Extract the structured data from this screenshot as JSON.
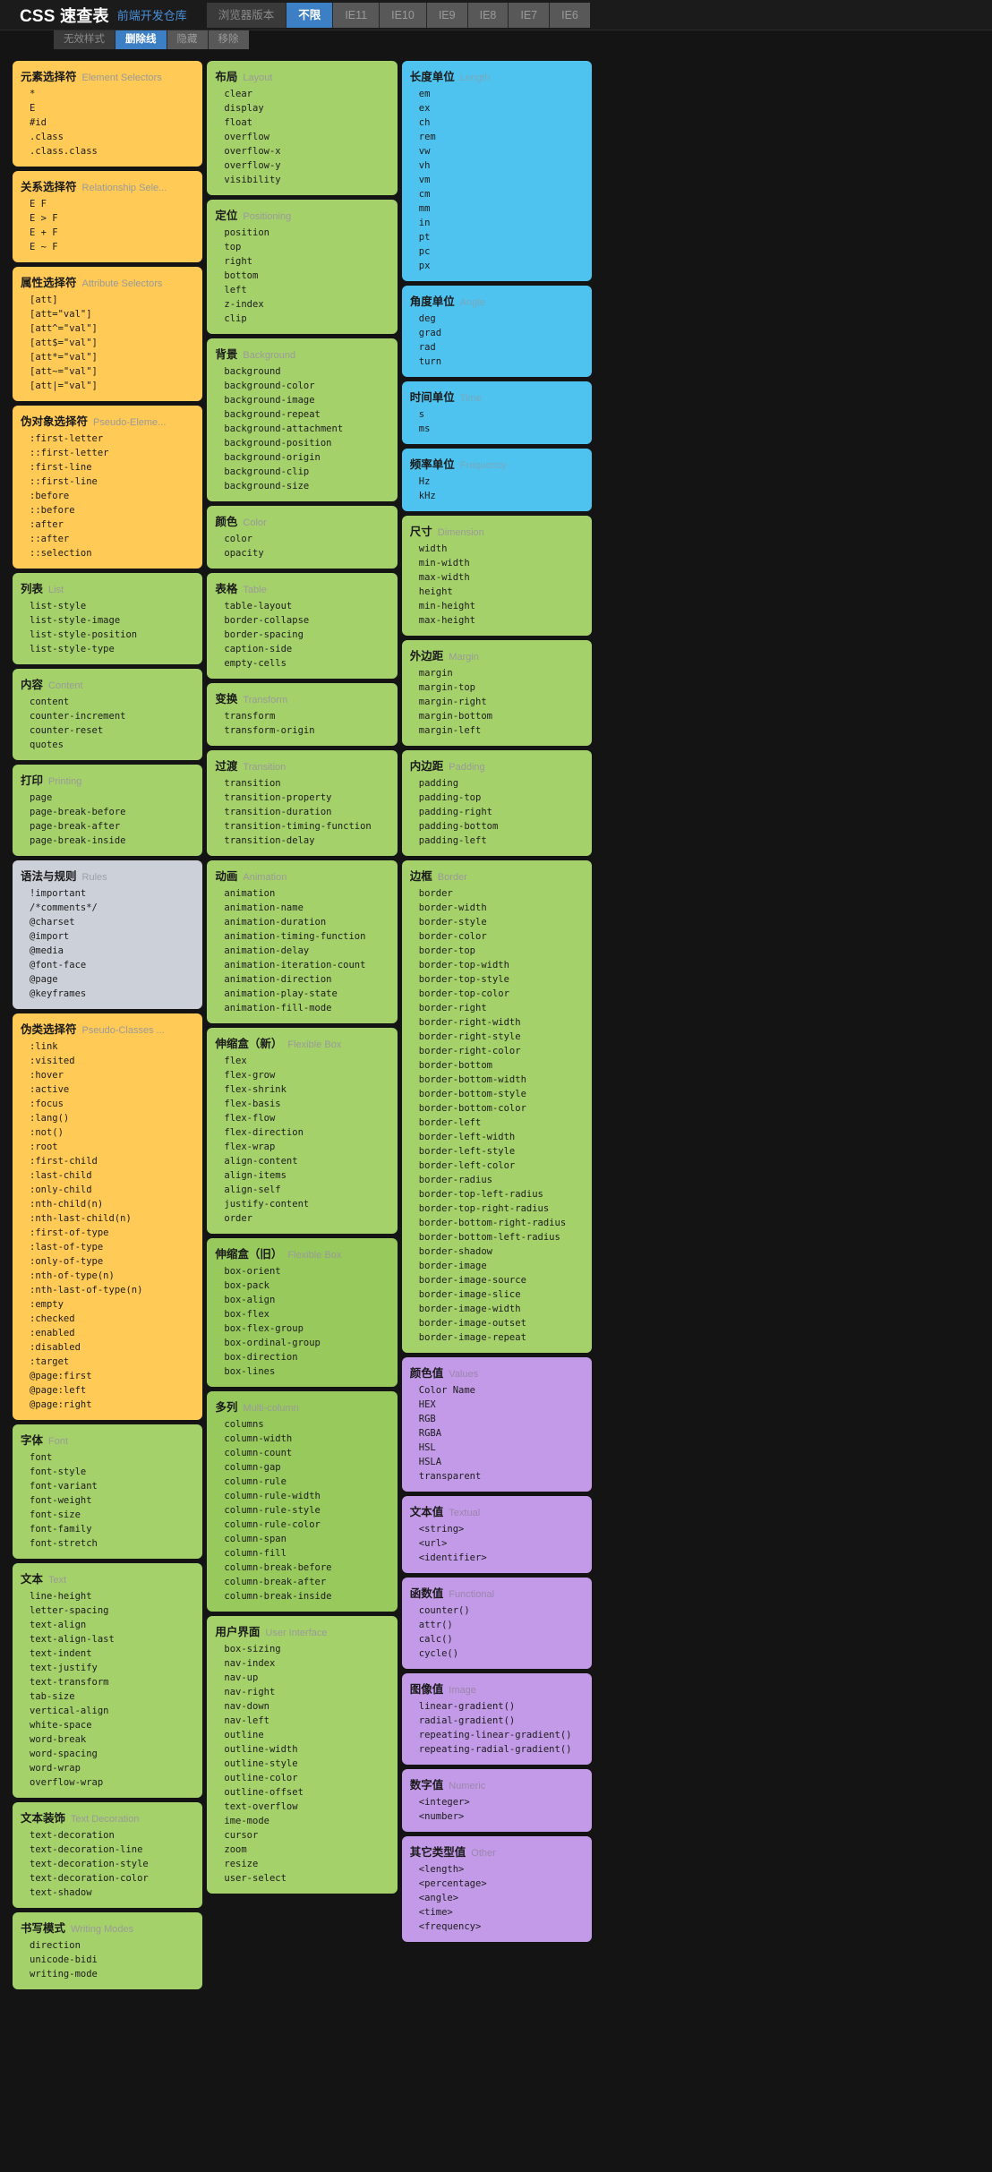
{
  "header": {
    "title_en": "CSS",
    "title_cn": "速查表",
    "subtitle": "前端开发仓库",
    "browser_label": "浏览器版本",
    "browser_options": [
      "不限",
      "IE11",
      "IE10",
      "IE9",
      "IE8",
      "IE7",
      "IE6"
    ],
    "browser_selected": "不限",
    "style_label": "无效样式",
    "style_options": [
      "删除线",
      "隐藏",
      "移除"
    ],
    "style_selected": "删除线"
  },
  "cards": [
    {
      "cn": "元素选择符",
      "en": "Element Selectors",
      "color": "c-yellow",
      "items": [
        "*",
        "E",
        "#id",
        ".class",
        ".class.class"
      ]
    },
    {
      "cn": "关系选择符",
      "en": "Relationship Sele...",
      "color": "c-yellow",
      "items": [
        "E F",
        "E > F",
        "E + F",
        "E ~ F"
      ]
    },
    {
      "cn": "属性选择符",
      "en": "Attribute Selectors",
      "color": "c-yellow",
      "items": [
        "[att]",
        "[att=\"val\"]",
        "[att^=\"val\"]",
        "[att$=\"val\"]",
        "[att*=\"val\"]",
        "[att~=\"val\"]",
        "[att|=\"val\"]"
      ]
    },
    {
      "cn": "伪对象选择符",
      "en": "Pseudo-Eleme...",
      "color": "c-yellow",
      "items": [
        ":first-letter",
        "::first-letter",
        ":first-line",
        "::first-line",
        ":before",
        "::before",
        ":after",
        "::after",
        "::selection"
      ]
    },
    {
      "cn": "列表",
      "en": "List",
      "color": "c-green",
      "items": [
        "list-style",
        "list-style-image",
        "list-style-position",
        "list-style-type"
      ]
    },
    {
      "cn": "内容",
      "en": "Content",
      "color": "c-green",
      "items": [
        "content",
        "counter-increment",
        "counter-reset",
        "quotes"
      ]
    },
    {
      "cn": "打印",
      "en": "Printing",
      "color": "c-green",
      "items": [
        "page",
        "page-break-before",
        "page-break-after",
        "page-break-inside"
      ]
    },
    {
      "cn": "语法与规则",
      "en": "Rules",
      "color": "c-gray",
      "items": [
        "!important",
        "/*comments*/",
        "@charset",
        "@import",
        "@media",
        "@font-face",
        "@page",
        "@keyframes"
      ]
    },
    {
      "cn": "伪类选择符",
      "en": "Pseudo-Classes ...",
      "color": "c-yellow",
      "items": [
        ":link",
        ":visited",
        ":hover",
        ":active",
        ":focus",
        ":lang()",
        ":not()",
        ":root",
        ":first-child",
        ":last-child",
        ":only-child",
        ":nth-child(n)",
        ":nth-last-child(n)",
        ":first-of-type",
        ":last-of-type",
        ":only-of-type",
        ":nth-of-type(n)",
        ":nth-last-of-type(n)",
        ":empty",
        ":checked",
        ":enabled",
        ":disabled",
        ":target",
        "@page:first",
        "@page:left",
        "@page:right"
      ]
    },
    {
      "cn": "字体",
      "en": "Font",
      "color": "c-green",
      "items": [
        "font",
        "font-style",
        "font-variant",
        "font-weight",
        "font-size",
        "font-family",
        "font-stretch"
      ]
    },
    {
      "cn": "文本",
      "en": "Text",
      "color": "c-green",
      "items": [
        "line-height",
        "letter-spacing",
        "text-align",
        "text-align-last",
        "text-indent",
        "text-justify",
        "text-transform",
        "tab-size",
        "vertical-align",
        "white-space",
        "word-break",
        "word-spacing",
        "word-wrap",
        "overflow-wrap"
      ]
    },
    {
      "cn": "文本装饰",
      "en": "Text Decoration",
      "color": "c-green",
      "items": [
        "text-decoration",
        "text-decoration-line",
        "text-decoration-style",
        "text-decoration-color",
        "text-shadow"
      ]
    },
    {
      "cn": "书写模式",
      "en": "Writing Modes",
      "color": "c-green",
      "items": [
        "direction",
        "unicode-bidi",
        "writing-mode"
      ]
    },
    {
      "cn": "布局",
      "en": "Layout",
      "color": "c-green",
      "items": [
        "clear",
        "display",
        "float",
        "overflow",
        "overflow-x",
        "overflow-y",
        "visibility"
      ]
    },
    {
      "cn": "定位",
      "en": "Positioning",
      "color": "c-green",
      "items": [
        "position",
        "top",
        "right",
        "bottom",
        "left",
        "z-index",
        "clip"
      ]
    },
    {
      "cn": "背景",
      "en": "Background",
      "color": "c-green",
      "items": [
        "background",
        "background-color",
        "background-image",
        "background-repeat",
        "background-attachment",
        "background-position",
        "background-origin",
        "background-clip",
        "background-size"
      ]
    },
    {
      "cn": "颜色",
      "en": "Color",
      "color": "c-green",
      "items": [
        "color",
        "opacity"
      ]
    },
    {
      "cn": "表格",
      "en": "Table",
      "color": "c-green",
      "items": [
        "table-layout",
        "border-collapse",
        "border-spacing",
        "caption-side",
        "empty-cells"
      ]
    },
    {
      "cn": "变换",
      "en": "Transform",
      "color": "c-green",
      "items": [
        "transform",
        "transform-origin"
      ]
    },
    {
      "cn": "过渡",
      "en": "Transition",
      "color": "c-green",
      "items": [
        "transition",
        "transition-property",
        "transition-duration",
        "transition-timing-function",
        "transition-delay"
      ]
    },
    {
      "cn": "动画",
      "en": "Animation",
      "color": "c-green",
      "items": [
        "animation",
        "animation-name",
        "animation-duration",
        "animation-timing-function",
        "animation-delay",
        "animation-iteration-count",
        "animation-direction",
        "animation-play-state",
        "animation-fill-mode"
      ]
    },
    {
      "cn": "伸缩盒（新）",
      "en": "Flexible Box",
      "color": "c-green",
      "items": [
        "flex",
        "flex-grow",
        "flex-shrink",
        "flex-basis",
        "flex-flow",
        "flex-direction",
        "flex-wrap",
        "align-content",
        "align-items",
        "align-self",
        "justify-content",
        "order"
      ]
    },
    {
      "cn": "伸缩盒（旧）",
      "en": "Flexible Box",
      "color": "c-green2",
      "items": [
        "box-orient",
        "box-pack",
        "box-align",
        "box-flex",
        "box-flex-group",
        "box-ordinal-group",
        "box-direction",
        "box-lines"
      ]
    },
    {
      "cn": "多列",
      "en": "Multi-column",
      "color": "c-green2",
      "items": [
        "columns",
        "column-width",
        "column-count",
        "column-gap",
        "column-rule",
        "column-rule-width",
        "column-rule-style",
        "column-rule-color",
        "column-span",
        "column-fill",
        "column-break-before",
        "column-break-after",
        "column-break-inside"
      ]
    },
    {
      "cn": "用户界面",
      "en": "User Interface",
      "color": "c-green",
      "items": [
        "box-sizing",
        "nav-index",
        "nav-up",
        "nav-right",
        "nav-down",
        "nav-left",
        "outline",
        "outline-width",
        "outline-style",
        "outline-color",
        "outline-offset",
        "text-overflow",
        "ime-mode",
        "cursor",
        "zoom",
        "resize",
        "user-select"
      ]
    },
    {
      "cn": "长度单位",
      "en": "Length",
      "color": "c-blue",
      "items": [
        "em",
        "ex",
        "ch",
        "rem",
        "vw",
        "vh",
        "vm",
        "cm",
        "mm",
        "in",
        "pt",
        "pc",
        "px"
      ]
    },
    {
      "cn": "角度单位",
      "en": "Angle",
      "color": "c-blue",
      "items": [
        "deg",
        "grad",
        "rad",
        "turn"
      ]
    },
    {
      "cn": "时间单位",
      "en": "Time",
      "color": "c-blue",
      "items": [
        "s",
        "ms"
      ]
    },
    {
      "cn": "频率单位",
      "en": "Frequency",
      "color": "c-blue",
      "items": [
        "Hz",
        "kHz"
      ]
    },
    {
      "cn": "尺寸",
      "en": "Dimension",
      "color": "c-green",
      "items": [
        "width",
        "min-width",
        "max-width",
        "height",
        "min-height",
        "max-height"
      ]
    },
    {
      "cn": "外边距",
      "en": "Margin",
      "color": "c-green",
      "items": [
        "margin",
        "margin-top",
        "margin-right",
        "margin-bottom",
        "margin-left"
      ]
    },
    {
      "cn": "内边距",
      "en": "Padding",
      "color": "c-green",
      "items": [
        "padding",
        "padding-top",
        "padding-right",
        "padding-bottom",
        "padding-left"
      ]
    },
    {
      "cn": "边框",
      "en": "Border",
      "color": "c-green",
      "items": [
        "border",
        "border-width",
        "border-style",
        "border-color",
        "border-top",
        "border-top-width",
        "border-top-style",
        "border-top-color",
        "border-right",
        "border-right-width",
        "border-right-style",
        "border-right-color",
        "border-bottom",
        "border-bottom-width",
        "border-bottom-style",
        "border-bottom-color",
        "border-left",
        "border-left-width",
        "border-left-style",
        "border-left-color",
        "border-radius",
        "border-top-left-radius",
        "border-top-right-radius",
        "border-bottom-right-radius",
        "border-bottom-left-radius",
        "border-shadow",
        "border-image",
        "border-image-source",
        "border-image-slice",
        "border-image-width",
        "border-image-outset",
        "border-image-repeat"
      ]
    },
    {
      "cn": "颜色值",
      "en": "Values",
      "color": "c-purple",
      "items": [
        "Color Name",
        "HEX",
        "RGB",
        "RGBA",
        "HSL",
        "HSLA",
        "transparent"
      ]
    },
    {
      "cn": "文本值",
      "en": "Textual",
      "color": "c-purple",
      "items": [
        "<string>",
        "<url>",
        "<identifier>"
      ]
    },
    {
      "cn": "函数值",
      "en": "Functional",
      "color": "c-purple",
      "items": [
        "counter()",
        "attr()",
        "calc()",
        "cycle()"
      ]
    },
    {
      "cn": "图像值",
      "en": "Image",
      "color": "c-purple",
      "items": [
        "linear-gradient()",
        "radial-gradient()",
        "repeating-linear-gradient()",
        "repeating-radial-gradient()"
      ]
    },
    {
      "cn": "数字值",
      "en": "Numeric",
      "color": "c-purple",
      "items": [
        "<integer>",
        "<number>"
      ]
    },
    {
      "cn": "其它类型值",
      "en": "Other",
      "color": "c-purple",
      "items": [
        "<length>",
        "<percentage>",
        "<angle>",
        "<time>",
        "<frequency>"
      ]
    }
  ]
}
